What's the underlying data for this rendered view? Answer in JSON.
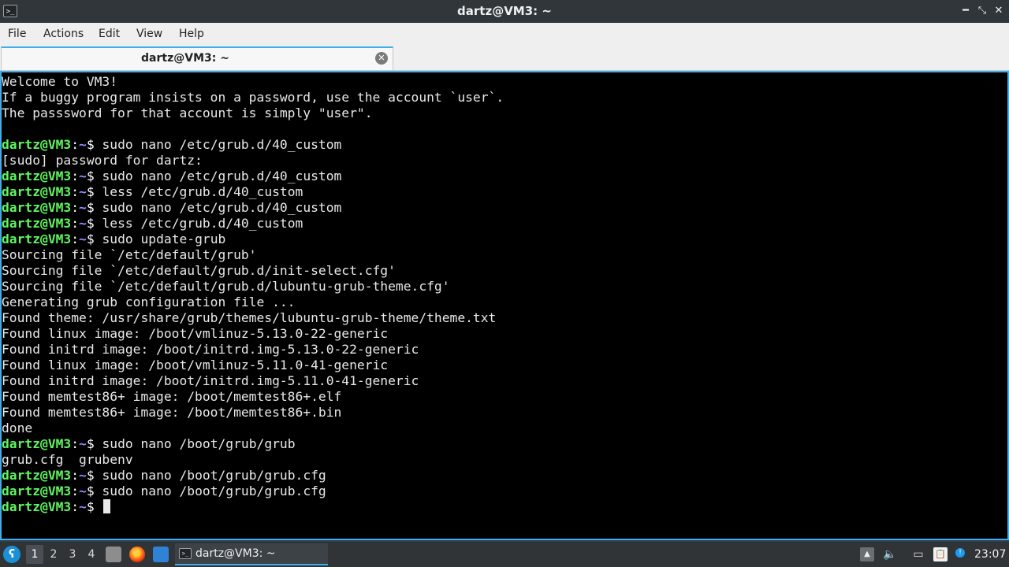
{
  "window": {
    "title": "dartz@VM3: ~",
    "app_icon": ">_",
    "minimize_icon": "━",
    "restore_icon": "⤡",
    "close_icon": "✕"
  },
  "menubar": {
    "items": [
      "File",
      "Actions",
      "Edit",
      "View",
      "Help"
    ]
  },
  "tabs": [
    {
      "label": "dartz@VM3: ~",
      "close_icon": "✕"
    }
  ],
  "terminal": {
    "prompt_user": "dartz@VM3",
    "prompt_sep": ":",
    "prompt_dir": "~",
    "prompt_sym": "$ ",
    "lines": [
      {
        "type": "out",
        "text": "Welcome to VM3!"
      },
      {
        "type": "out",
        "text": "If a buggy program insists on a password, use the account `user`."
      },
      {
        "type": "out",
        "text": "The passsword for that account is simply \"user\"."
      },
      {
        "type": "out",
        "text": ""
      },
      {
        "type": "cmd",
        "text": "sudo nano /etc/grub.d/40_custom"
      },
      {
        "type": "out",
        "text": "[sudo] password for dartz:"
      },
      {
        "type": "cmd",
        "text": "sudo nano /etc/grub.d/40_custom"
      },
      {
        "type": "cmd",
        "text": "less /etc/grub.d/40_custom"
      },
      {
        "type": "cmd",
        "text": "sudo nano /etc/grub.d/40_custom"
      },
      {
        "type": "cmd",
        "text": "less /etc/grub.d/40_custom"
      },
      {
        "type": "cmd",
        "text": "sudo update-grub"
      },
      {
        "type": "out",
        "text": "Sourcing file `/etc/default/grub'"
      },
      {
        "type": "out",
        "text": "Sourcing file `/etc/default/grub.d/init-select.cfg'"
      },
      {
        "type": "out",
        "text": "Sourcing file `/etc/default/grub.d/lubuntu-grub-theme.cfg'"
      },
      {
        "type": "out",
        "text": "Generating grub configuration file ..."
      },
      {
        "type": "out",
        "text": "Found theme: /usr/share/grub/themes/lubuntu-grub-theme/theme.txt"
      },
      {
        "type": "out",
        "text": "Found linux image: /boot/vmlinuz-5.13.0-22-generic"
      },
      {
        "type": "out",
        "text": "Found initrd image: /boot/initrd.img-5.13.0-22-generic"
      },
      {
        "type": "out",
        "text": "Found linux image: /boot/vmlinuz-5.11.0-41-generic"
      },
      {
        "type": "out",
        "text": "Found initrd image: /boot/initrd.img-5.11.0-41-generic"
      },
      {
        "type": "out",
        "text": "Found memtest86+ image: /boot/memtest86+.elf"
      },
      {
        "type": "out",
        "text": "Found memtest86+ image: /boot/memtest86+.bin"
      },
      {
        "type": "out",
        "text": "done"
      },
      {
        "type": "cmd",
        "text": "sudo nano /boot/grub/grub"
      },
      {
        "type": "out",
        "text": "grub.cfg  grubenv"
      },
      {
        "type": "cmd",
        "text": "sudo nano /boot/grub/grub.cfg"
      },
      {
        "type": "cmd",
        "text": "sudo nano /boot/grub/grub.cfg"
      },
      {
        "type": "cmd",
        "text": "",
        "cursor": true
      }
    ]
  },
  "taskbar": {
    "start_icon": "ʕ",
    "workspaces": [
      "1",
      "2",
      "3",
      "4"
    ],
    "active_workspace": "1",
    "quicklaunch": [
      "file-manager-icon",
      "firefox-icon",
      "show-desktop-icon"
    ],
    "task": {
      "label": "dartz@VM3: ~",
      "icon": ">_"
    },
    "tray": {
      "up_icon": "▲",
      "volume_icon": "🔈",
      "network_icon": "▭",
      "clipboard_icon": "📋",
      "info_icon": "!"
    },
    "clock": "23:07"
  },
  "colors": {
    "accent": "#3daee9",
    "prompt_user": "#5ff55f",
    "prompt_dir": "#8f8fff",
    "terminal_bg": "#000000"
  }
}
